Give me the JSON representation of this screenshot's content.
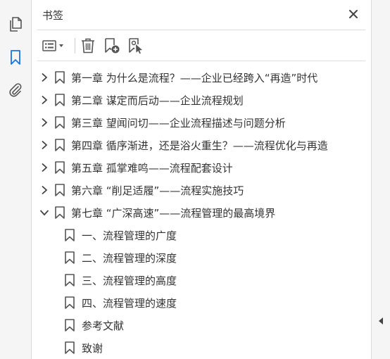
{
  "panel": {
    "title": "书签",
    "close_icon": "close-icon"
  },
  "sidebar": {
    "tools": [
      {
        "name": "pages-icon",
        "active": false
      },
      {
        "name": "bookmark-icon",
        "active": true
      },
      {
        "name": "attachment-icon",
        "active": false
      }
    ]
  },
  "toolbar": {
    "buttons": [
      "options-menu-icon",
      "delete-icon",
      "new-bookmark-icon",
      "new-bookmark-from-selection-icon"
    ]
  },
  "bookmarks": [
    {
      "label": "第一章  为什么是流程？——企业已经跨入“再造”时代",
      "expanded": false
    },
    {
      "label": "第二章  谋定而后动——企业流程规划",
      "expanded": false
    },
    {
      "label": "第三章  望闻问切——企业流程描述与问题分析",
      "expanded": false
    },
    {
      "label": "第四章  循序渐进，还是浴火重生？——流程优化与再造",
      "expanded": false
    },
    {
      "label": "第五章  孤掌难鸣——流程配套设计",
      "expanded": false
    },
    {
      "label": "第六章  “削足适履”——流程实施技巧",
      "expanded": false
    },
    {
      "label": "第七章  “广深高速”——流程管理的最高境界",
      "expanded": true,
      "children": [
        {
          "label": "一、流程管理的广度"
        },
        {
          "label": "二、流程管理的深度"
        },
        {
          "label": "三、流程管理的高度"
        },
        {
          "label": "四、流程管理的速度"
        }
      ]
    },
    {
      "label": "参考文献",
      "level": 1
    },
    {
      "label": "致谢",
      "level": 1
    }
  ],
  "colors": {
    "accent": "#1473e6",
    "icon": "#555555",
    "text": "#333333"
  }
}
